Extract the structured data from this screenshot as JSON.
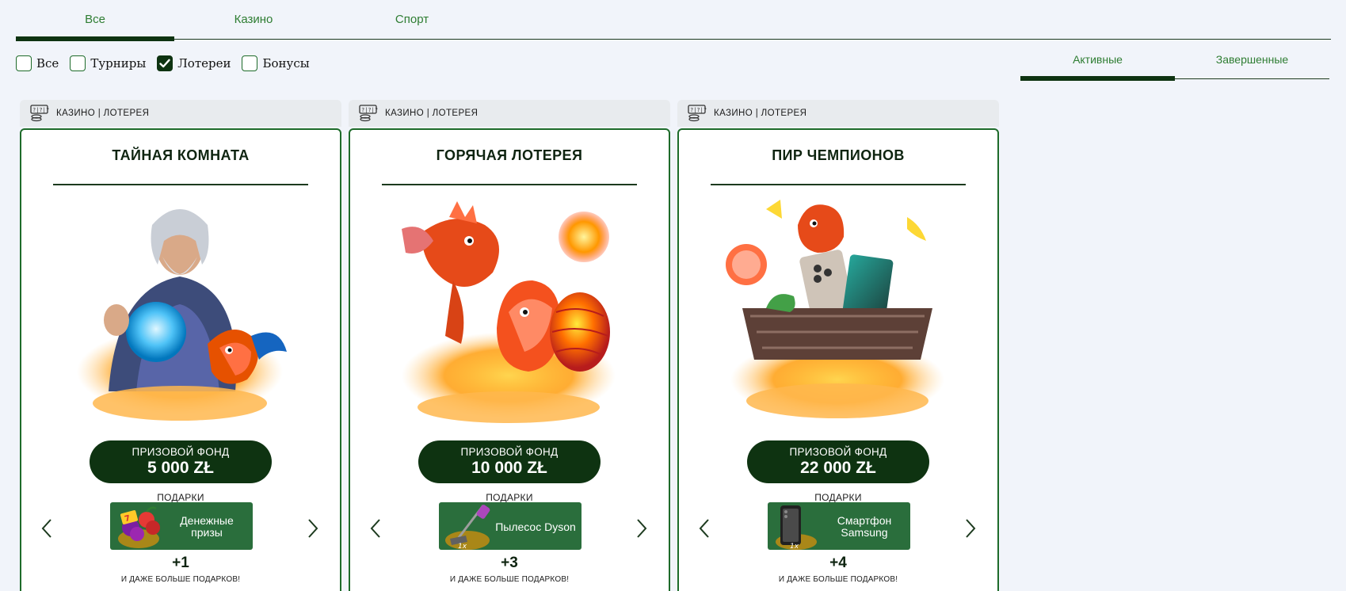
{
  "top_tabs": [
    {
      "label": "Все",
      "active": true
    },
    {
      "label": "Казино",
      "active": false
    },
    {
      "label": "Спорт",
      "active": false
    }
  ],
  "filters": [
    {
      "label": "Все",
      "checked": false
    },
    {
      "label": "Турниры",
      "checked": false
    },
    {
      "label": "Лотереи",
      "checked": true
    },
    {
      "label": "Бонусы",
      "checked": false
    }
  ],
  "status_tabs": [
    {
      "label": "Активные",
      "active": true
    },
    {
      "label": "Завершенные",
      "active": false
    }
  ],
  "cards": [
    {
      "category": "КАЗИНО | ЛОТЕРЕЯ",
      "title": "ТАЙНАЯ КОМНАТА",
      "art": "wizard-with-crystal-ball-and-bird",
      "prize_label": "ПРИЗОВОЙ ФОНД",
      "prize_value": "5 000 ZŁ",
      "gifts_label": "ПОДАРКИ",
      "gift": {
        "name": "Денежные призы",
        "icon": "slot-fruits-icon",
        "badge": ""
      },
      "more_count": "+1",
      "more_text": "И ДАЖЕ БОЛЬШЕ ПОДАРКОВ!"
    },
    {
      "category": "КАЗИНО | ЛОТЕРЕЯ",
      "title": "ГОРЯЧАЯ ЛОТЕРЕЯ",
      "art": "fire-dragon-and-bird-with-egg",
      "prize_label": "ПРИЗОВОЙ ФОНД",
      "prize_value": "10 000 ZŁ",
      "gifts_label": "ПОДАРКИ",
      "gift": {
        "name": "Пылесос Dyson",
        "icon": "vacuum-cleaner-icon",
        "badge": "1x"
      },
      "more_count": "+3",
      "more_text": "И ДАЖЕ БОЛЬШЕ ПОДАРКОВ!"
    },
    {
      "category": "КАЗИНО | ЛОТЕРЕЯ",
      "title": "ПИР ЧЕМПИОНОВ",
      "art": "bird-with-shopping-basket-and-phone",
      "prize_label": "ПРИЗОВОЙ ФОНД",
      "prize_value": "22 000 ZŁ",
      "gifts_label": "ПОДАРКИ",
      "gift": {
        "name": "Смартфон Samsung",
        "icon": "smartphone-icon",
        "badge": "1x"
      },
      "more_count": "+4",
      "more_text": "И ДАЖЕ БОЛЬШЕ ПОДАРКОВ!"
    }
  ],
  "colors": {
    "accent_dark": "#0e3311",
    "accent_green": "#2e7d32",
    "gift_green": "#2a6e3c",
    "background": "#f1f4fa"
  }
}
